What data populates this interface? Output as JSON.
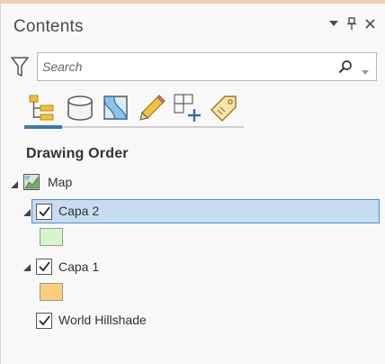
{
  "panel": {
    "title": "Contents",
    "controls": {
      "menu_icon": "chevron-down-icon",
      "pin_icon": "pin-icon",
      "close_icon": "close-icon"
    }
  },
  "search": {
    "placeholder": "Search",
    "value": ""
  },
  "toolbar": {
    "buttons": [
      {
        "icon": "list-by-drawing-order-icon",
        "active": true
      },
      {
        "icon": "list-by-data-source-icon",
        "active": false
      },
      {
        "icon": "list-by-selection-icon",
        "active": false
      },
      {
        "icon": "list-by-editing-icon",
        "active": false
      },
      {
        "icon": "list-by-snapping-icon",
        "active": false
      },
      {
        "icon": "list-by-labeling-icon",
        "active": false
      }
    ]
  },
  "section": {
    "heading": "Drawing Order"
  },
  "tree": {
    "map": {
      "label": "Map",
      "expanded": true
    },
    "layers": [
      {
        "label": "Capa 2",
        "checked": true,
        "expanded": true,
        "selected": true,
        "swatch_color": "#d6f5cc"
      },
      {
        "label": "Capa 1",
        "checked": true,
        "expanded": true,
        "selected": false,
        "swatch_color": "#fbcc7a"
      },
      {
        "label": "World Hillshade",
        "checked": true,
        "expanded": false,
        "selected": false
      }
    ]
  },
  "colors": {
    "accent": "#3a76b8",
    "selection_fill": "#c6dcf0",
    "selection_border": "#4d8ed1",
    "header_strip": "#f2ccb2"
  }
}
